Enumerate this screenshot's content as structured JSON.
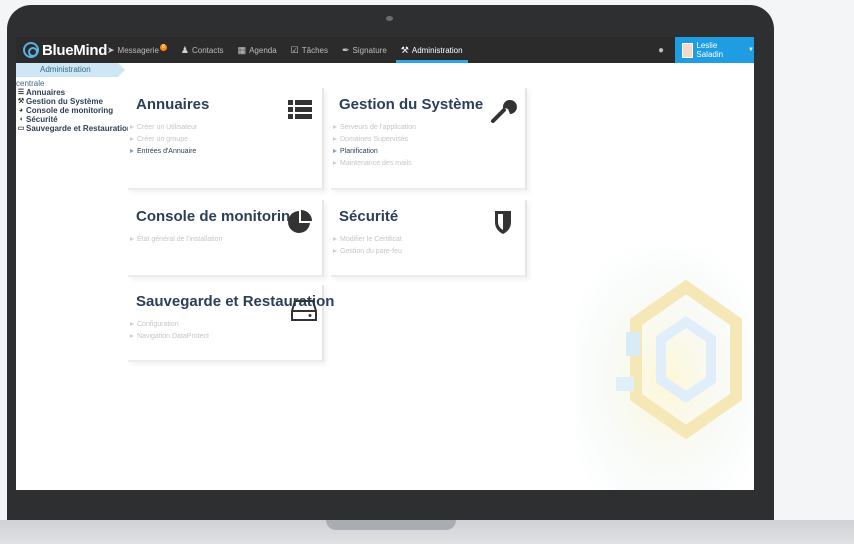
{
  "app": {
    "name": "BlueMind"
  },
  "nav": [
    {
      "label": "Messagerie",
      "icon": "paper-plane-icon",
      "badge": "8",
      "active": false
    },
    {
      "label": "Contacts",
      "icon": "contacts-icon",
      "active": false
    },
    {
      "label": "Agenda",
      "icon": "calendar-icon",
      "active": false
    },
    {
      "label": "Tâches",
      "icon": "tasks-icon",
      "active": false
    },
    {
      "label": "Signature",
      "icon": "pen-icon",
      "active": false
    },
    {
      "label": "Administration",
      "icon": "wrench-icon",
      "active": true
    }
  ],
  "user": {
    "name": "Leslie Saladin",
    "caret": "▼"
  },
  "breadcrumb": "Administration centrale",
  "sidebar": [
    {
      "label": "Annuaires",
      "icon": "list-icon"
    },
    {
      "label": "Gestion du Système",
      "icon": "wrench-icon"
    },
    {
      "label": "Console de monitoring",
      "icon": "pie-chart-icon"
    },
    {
      "label": "Sécurité",
      "icon": "shield-icon"
    },
    {
      "label": "Sauvegarde et Restauration",
      "icon": "drive-icon"
    }
  ],
  "cards": [
    {
      "title": "Annuaires",
      "icon": "list-icon",
      "links": [
        "Créer un Utilisateur",
        "Créer un groupe",
        "Entrées d'Annuaire"
      ]
    },
    {
      "title": "Gestion du Système",
      "icon": "wrench-icon",
      "links": [
        "Serveurs de l'application",
        "Domaines Supervisés",
        "Planification",
        "Maintenance des mails"
      ]
    },
    {
      "title": "Console de monitoring",
      "icon": "pie-chart-icon",
      "links": [
        "État général de l'installation"
      ]
    },
    {
      "title": "Sécurité",
      "icon": "shield-icon",
      "links": [
        "Modifier le Certificat",
        "Gestion du pare-feu"
      ]
    },
    {
      "title": "Sauvegarde et Restauration",
      "icon": "drive-icon",
      "links": [
        "Configuration",
        "Navigation DataProtect"
      ]
    }
  ],
  "colors": {
    "accent": "#1f9de3",
    "topbar": "#2b2b2b",
    "title": "#2c3f58",
    "crumb": "#cde7f4"
  }
}
